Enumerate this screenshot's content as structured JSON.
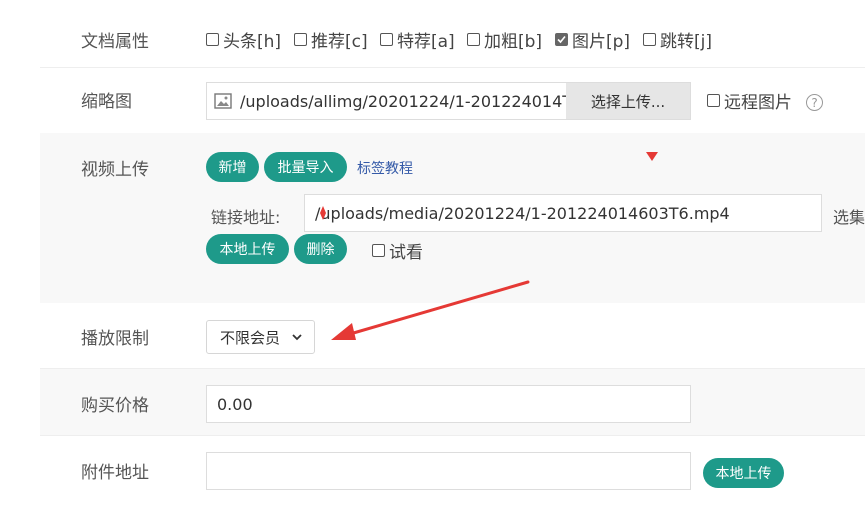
{
  "attributes": {
    "label": "文档属性",
    "options": [
      {
        "text": "头条[h]",
        "checked": false
      },
      {
        "text": "推荐[c]",
        "checked": false
      },
      {
        "text": "特荐[a]",
        "checked": false
      },
      {
        "text": "加粗[b]",
        "checked": false
      },
      {
        "text": "图片[p]",
        "checked": true
      },
      {
        "text": "跳转[j]",
        "checked": false
      }
    ]
  },
  "thumbnail": {
    "label": "缩略图",
    "path": "/uploads/allimg/20201224/1-201224014T",
    "choose_button": "选择上传...",
    "remote_checkbox": "远程图片",
    "help_icon": "?"
  },
  "video_upload": {
    "label": "视频上传",
    "add_button": "新增",
    "batch_import_button": "批量导入",
    "tag_tutorial_link": "标签教程",
    "link_label": "链接地址:",
    "link_value": "/uploads/media/20201224/1-201224014603T6.mp4",
    "select_text": "选集",
    "local_upload_button": "本地上传",
    "delete_button": "删除",
    "preview_checkbox": "试看"
  },
  "play_limit": {
    "label": "播放限制",
    "selected": "不限会员"
  },
  "price": {
    "label": "购买价格",
    "value": "0.00"
  },
  "attachment": {
    "label": "附件地址",
    "value": "",
    "local_upload_button": "本地上传"
  },
  "colors": {
    "teal": "#1e9a8a",
    "annotation_red": "#e53935"
  }
}
